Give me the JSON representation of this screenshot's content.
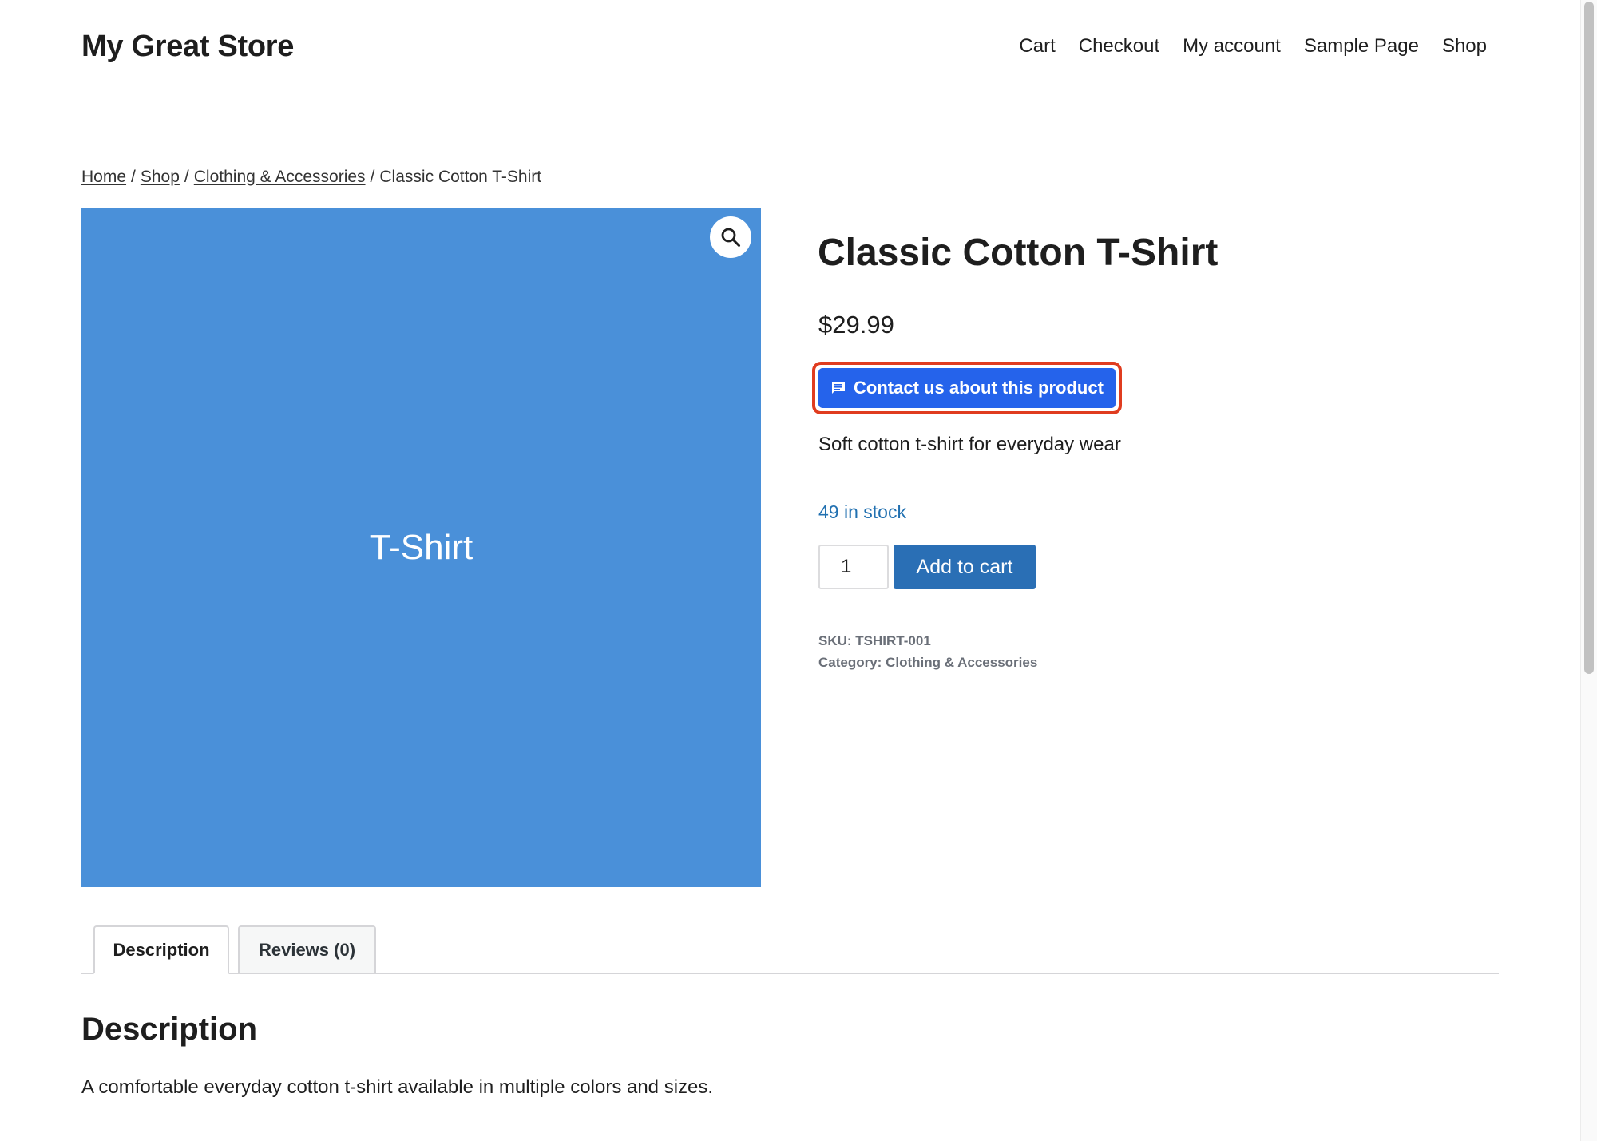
{
  "site": {
    "title": "My Great Store"
  },
  "nav": {
    "items": [
      {
        "label": "Cart"
      },
      {
        "label": "Checkout"
      },
      {
        "label": "My account"
      },
      {
        "label": "Sample Page"
      },
      {
        "label": "Shop"
      }
    ]
  },
  "breadcrumb": {
    "home": "Home",
    "shop": "Shop",
    "category": "Clothing & Accessories",
    "current": "Classic Cotton T-Shirt",
    "separator": "/"
  },
  "product": {
    "image_label": "T-Shirt",
    "image_color": "#4a90d9",
    "zoom_icon": "magnifier-icon",
    "title": "Classic Cotton T-Shirt",
    "price": "$29.99",
    "contact_button_label": "Contact us about this product",
    "contact_icon": "chat-bubble-icon",
    "short_description": "Soft cotton t-shirt for everyday wear",
    "stock": "49 in stock",
    "quantity": "1",
    "add_to_cart_label": "Add to cart",
    "sku_label": "SKU:",
    "sku_value": "TSHIRT-001",
    "category_label": "Category:",
    "category_value": "Clothing & Accessories"
  },
  "tabs": [
    {
      "label": "Description",
      "active": true
    },
    {
      "label": "Reviews (0)",
      "active": false
    }
  ],
  "description": {
    "heading": "Description",
    "body": "A comfortable everyday cotton t-shirt available in multiple colors and sizes."
  },
  "colors": {
    "accent_blue": "#2563eb",
    "highlight_outline": "#e03c1f",
    "add_to_cart": "#2a6fb5",
    "stock_link": "#2271b1"
  }
}
